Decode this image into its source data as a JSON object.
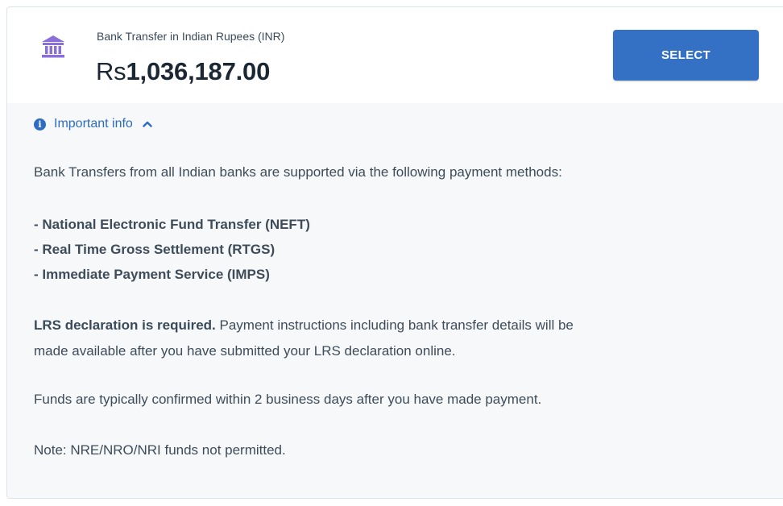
{
  "payment_option": {
    "icon": "bank-icon",
    "method_label": "Bank Transfer in Indian Rupees (INR)",
    "currency_symbol": "Rs",
    "amount": "1,036,187.00",
    "select_label": "SELECT"
  },
  "info": {
    "toggle_label": "Important info",
    "toggle_icon": "info-circle-icon",
    "chevron_icon": "chevron-up-icon",
    "intro": "Bank Transfers from all Indian banks are supported via the following payment methods:",
    "methods": [
      "- National Electronic Fund Transfer (NEFT)",
      "- Real Time Gross Settlement (RTGS)",
      "- Immediate Payment Service (IMPS)"
    ],
    "lrs_bold": "LRS declaration is required.",
    "lrs_line1": " Payment instructions including bank transfer details will be",
    "lrs_line2": "made available after you have submitted your LRS declaration online.",
    "funds_note": "Funds are typically confirmed within 2 business days after you have made payment.",
    "nre_note": "Note: NRE/NRO/NRI funds not permitted."
  },
  "colors": {
    "accent": "#3470c4",
    "link": "#2d6cc0",
    "icon_purple": "#8a6fd6",
    "panel_bg": "#f6f8f9"
  }
}
